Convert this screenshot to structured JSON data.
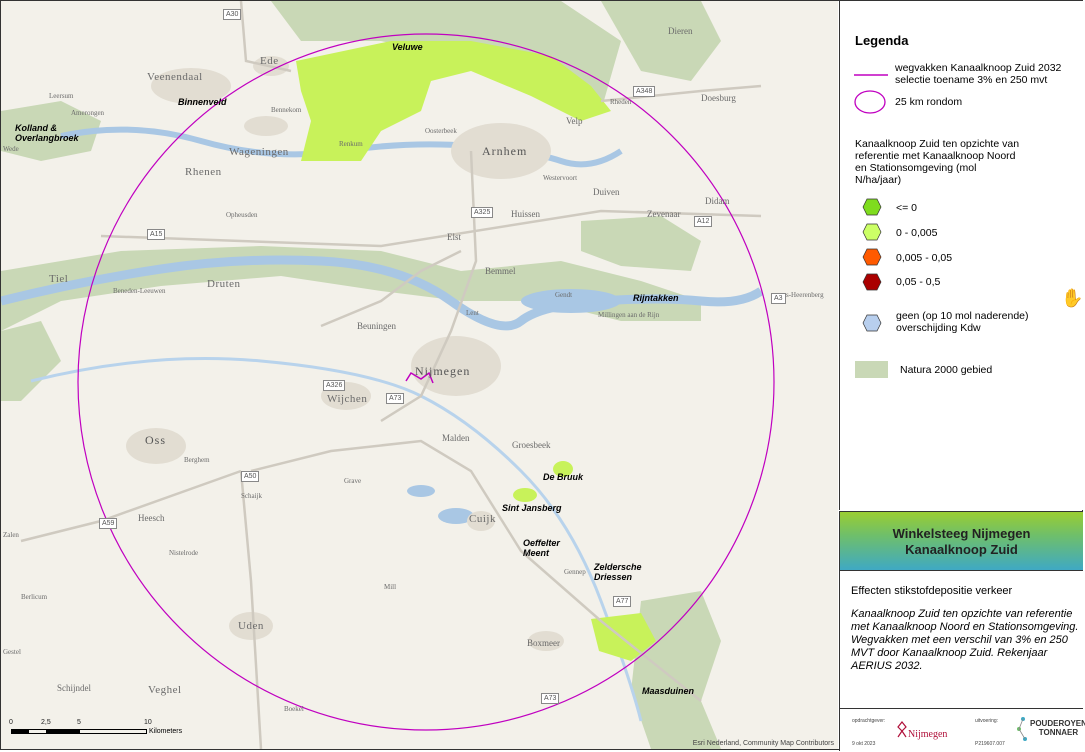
{
  "legend": {
    "title": "Legenda",
    "items": [
      {
        "label": "wegvakken Kanaalknoop Zuid 2032 selectie toename 3% en 250 mvt",
        "color": "#c000c0"
      },
      {
        "label": "25 km rondom",
        "color": "#c000c0"
      }
    ],
    "section_title": "Kanaalknoop Zuid ten opzichte van referentie met Kanaalknoop Noord en Stationsomgeving (mol N/ha/jaar)",
    "classes": [
      {
        "label": "<= 0",
        "color": "#7fdc1e"
      },
      {
        "label": "0 - 0,005",
        "color": "#ccff66"
      },
      {
        "label": "0,005 - 0,05",
        "color": "#ff5a00"
      },
      {
        "label": "0,05 - 0,5",
        "color": "#aa0000"
      },
      {
        "label": "geen (op 10 mol naderende) overschijding Kdw",
        "color": "#b8cfee"
      }
    ],
    "natura": {
      "label": "Natura 2000 gebied",
      "color": "#c9d8b6"
    }
  },
  "title_box": {
    "line1": "Winkelsteeg Nijmegen",
    "line2": "Kanaalknoop Zuid"
  },
  "description": {
    "heading": "Effecten stikstofdepositie verkeer",
    "body": "Kanaalknoop Zuid ten opzichte van referentie met Kanaalknoop Noord en Stationsomgeving. Wegvakken met een verschil van 3% en 250 MVT door Kanaalknoop Zuid. Rekenjaar AERIUS 2032."
  },
  "footer": {
    "client_label": "opdrachtgever:",
    "client": "Nijmegen",
    "contractor_label": "uitvoering:",
    "contractor_line1": "POUDEROYEN",
    "contractor_line2": "TONNAER",
    "date": "9 okt 2023",
    "code": "P219607.007"
  },
  "map": {
    "attribution": "Esri Nederland, Community Map Contributors",
    "scale": {
      "labels": [
        "0",
        "2,5",
        "5",
        "10"
      ],
      "unit": "Kilometers"
    },
    "natura_labels": [
      "Veluwe",
      "Binnenveld",
      "Kolland & Overlangbroek",
      "Rijntakken",
      "De Bruuk",
      "Sint Jansberg",
      "Oeffelter Meent",
      "Zeldersche Driessen",
      "Maasduinen"
    ],
    "places_large": [
      "Veenendaal",
      "Ede",
      "Wageningen",
      "Arnhem",
      "Rhenen",
      "Tiel",
      "Druten",
      "Beuningen",
      "Nijmegen",
      "Wijchen",
      "Oss",
      "Uden",
      "Veghel",
      "Cuijk",
      "Malden",
      "Groesbeek",
      "Boxmeer",
      "Bemmel",
      "Huissen",
      "Duiven",
      "Velp",
      "Zevenaar",
      "Doesburg",
      "Dieren",
      "Elst",
      "Heesch",
      "Schijndel",
      "Rheden",
      "Didam"
    ],
    "places_small": [
      "Leersum",
      "Amerongen",
      "Bennekom",
      "Renkum",
      "Oosterbeek",
      "Westervoort",
      "Opheusden",
      "Lent",
      "Gendt",
      "Millingen aan de Rijn",
      "Beneden-Leeuwen",
      "Berghem",
      "Schaijk",
      "Grave",
      "Nistelrode",
      "Mill",
      "Berlicum",
      "Gennep",
      "Boekel",
      "Wede",
      "Zalen",
      "Gestel",
      "s-Heerenberg"
    ],
    "roads": [
      "A30",
      "A348",
      "A325",
      "A15",
      "A12",
      "A3",
      "A326",
      "A73",
      "A50",
      "A59",
      "A77",
      "A73"
    ]
  }
}
